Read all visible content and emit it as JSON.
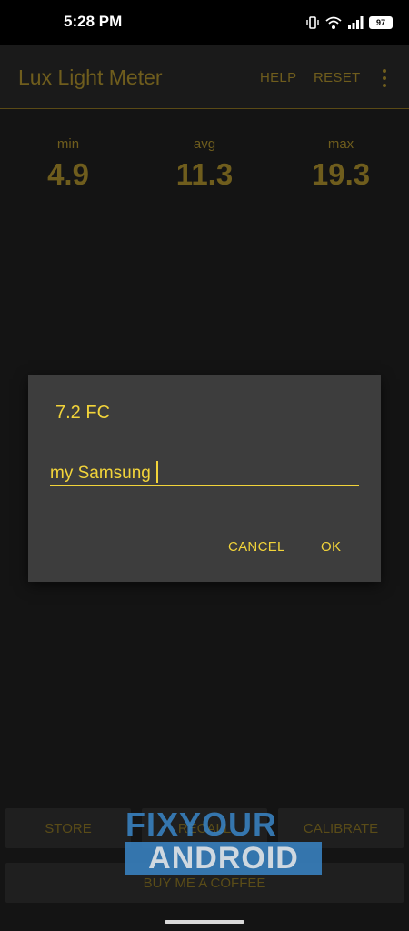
{
  "status_bar": {
    "time": "5:28 PM",
    "battery": "97",
    "icons": [
      "vibrate-icon",
      "wifi-icon",
      "signal-icon",
      "battery-icon"
    ]
  },
  "app_bar": {
    "title": "Lux Light Meter",
    "help_label": "HELP",
    "reset_label": "RESET",
    "menu_icon": "overflow-menu-icon"
  },
  "stats": {
    "min_label": "min",
    "min_value": "4.9",
    "avg_label": "avg",
    "avg_value": "11.3",
    "max_label": "max",
    "max_value": "19.3"
  },
  "dialog": {
    "title": "7.2 FC",
    "input_value": "my Samsung",
    "cancel_label": "CANCEL",
    "ok_label": "OK"
  },
  "bottom_buttons": {
    "store_label": "STORE",
    "recall_label": "RECALL",
    "calibrate_label": "CALIBRATE",
    "coffee_label": "BUY ME A COFFEE"
  },
  "watermark": {
    "line1": "FIXYOUR",
    "line2": "ANDROID"
  },
  "colors": {
    "accent": "#f2d43a",
    "dim_accent": "#6f5d1d",
    "dialog_bg": "#3d3d3d",
    "background": "#141414"
  }
}
